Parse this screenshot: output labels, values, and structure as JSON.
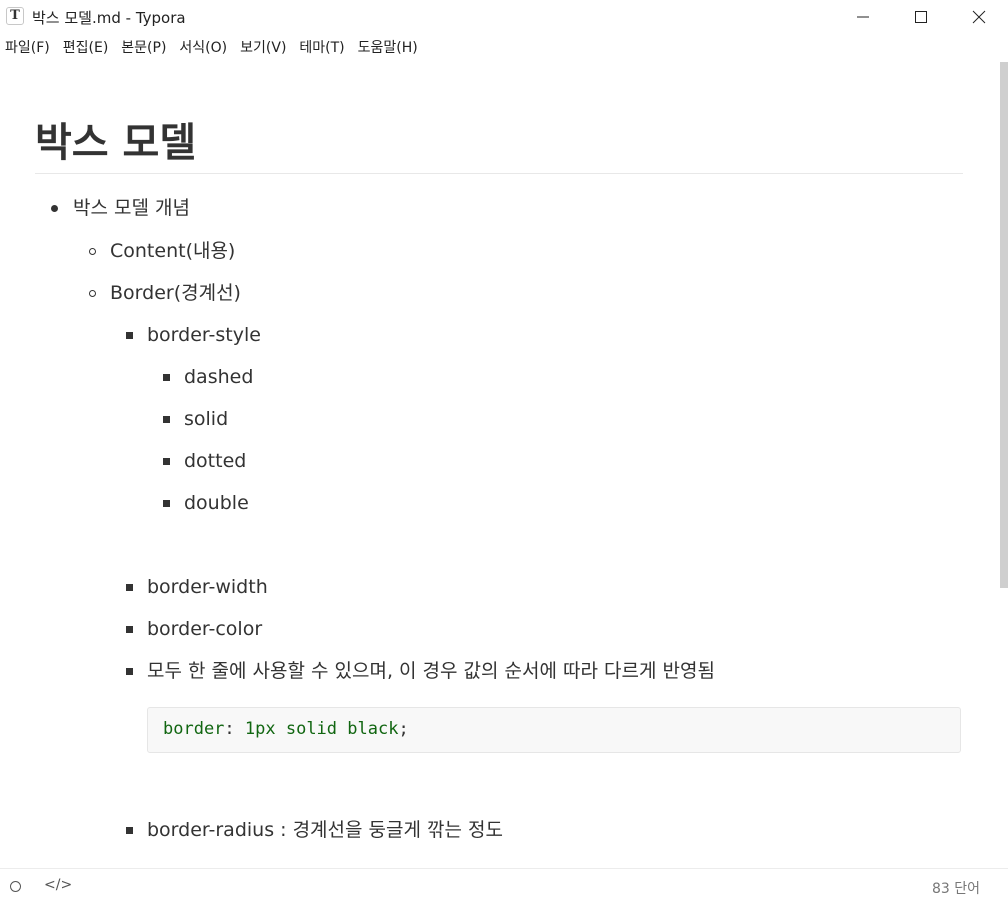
{
  "window": {
    "title": "박스 모델.md - Typora",
    "app_icon_letter": "T"
  },
  "menu": [
    "파일(F)",
    "편집(E)",
    "본문(P)",
    "서식(O)",
    "보기(V)",
    "테마(T)",
    "도움말(H)"
  ],
  "document": {
    "heading": "박스 모델",
    "items": [
      {
        "level": 1,
        "text": "박스 모델 개념"
      },
      {
        "level": 2,
        "text": "Content(내용)"
      },
      {
        "level": 2,
        "text": "Border(경계선)"
      },
      {
        "level": 3,
        "text": "border-style"
      },
      {
        "level": 4,
        "text": "dashed"
      },
      {
        "level": 4,
        "text": "solid"
      },
      {
        "level": 4,
        "text": "dotted"
      },
      {
        "level": 4,
        "text": "double"
      },
      {
        "level": 3,
        "text": "border-width"
      },
      {
        "level": 3,
        "text": "border-color"
      },
      {
        "level": 3,
        "text": "모두 한 줄에 사용할 수 있으며, 이 경우 값의 순서에 따라 다르게 반영됨"
      },
      {
        "level": 3,
        "text": "border-radius : 경계선을 둥글게 깎는 정도"
      }
    ],
    "code": {
      "prop": "border",
      "colon": ": ",
      "value": "1px solid black",
      "end": ";"
    }
  },
  "footer": {
    "code_icon": "</>",
    "word_count": "83 단어"
  },
  "colors": {
    "code_green": "#116611",
    "text": "#333333"
  }
}
